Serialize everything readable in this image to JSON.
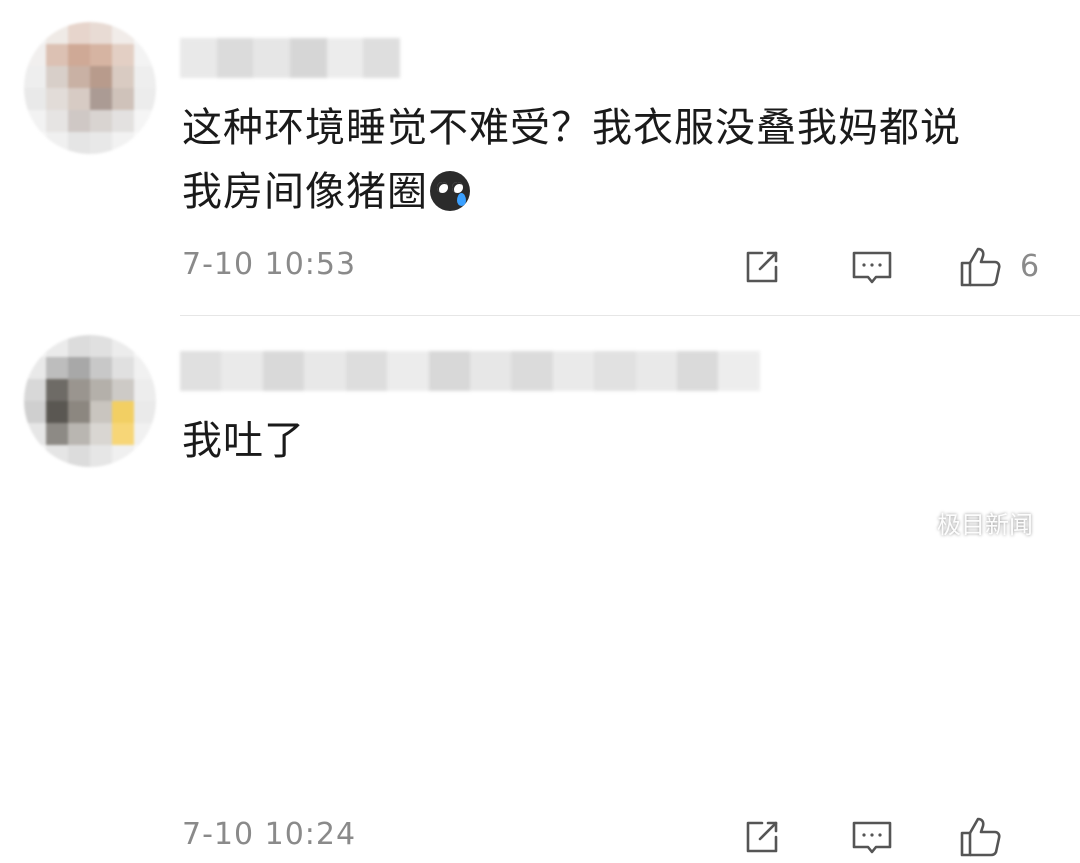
{
  "comments": [
    {
      "text_line1": "这种环境睡觉不难受？我衣服没叠我妈都说",
      "text_line2": "我房间像猪圈",
      "emoji": "crying-face-icon",
      "time": "7-10 10:53",
      "like_count": "6"
    },
    {
      "text_line1": "我吐了",
      "time": "7-10 10:24",
      "like_count": ""
    }
  ],
  "icons": {
    "share": "share-icon",
    "reply": "reply-icon",
    "like": "thumbs-up-icon"
  },
  "watermark": {
    "text": "极目新闻"
  },
  "colors": {
    "text": "#1a1a1a",
    "meta": "#8a8a8a",
    "divider": "#e6e6e6"
  }
}
